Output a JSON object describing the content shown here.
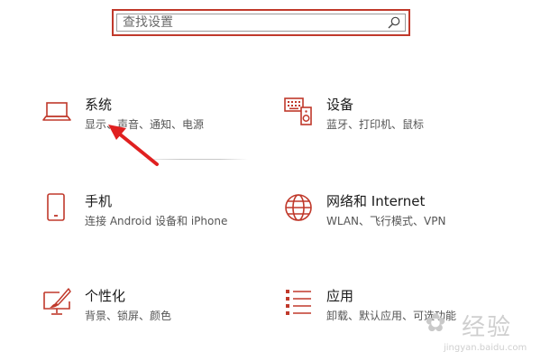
{
  "search": {
    "placeholder": "查找设置"
  },
  "tiles": [
    {
      "title": "系统",
      "desc": "显示、声音、通知、电源",
      "icon": "laptop-icon"
    },
    {
      "title": "设备",
      "desc": "蓝牙、打印机、鼠标",
      "icon": "keyboard-speaker-icon"
    },
    {
      "title": "手机",
      "desc": "连接 Android 设备和 iPhone",
      "icon": "phone-icon"
    },
    {
      "title": "网络和 Internet",
      "desc": "WLAN、飞行模式、VPN",
      "icon": "globe-icon"
    },
    {
      "title": "个性化",
      "desc": "背景、锁屏、颜色",
      "icon": "paint-brush-icon"
    },
    {
      "title": "应用",
      "desc": "卸载、默认应用、可选功能",
      "icon": "apps-list-icon"
    }
  ],
  "watermark": {
    "brand": "经验",
    "url": "jingyan.baidu.com"
  },
  "colors": {
    "accent": "#c0392b",
    "arrow": "#e02020"
  }
}
